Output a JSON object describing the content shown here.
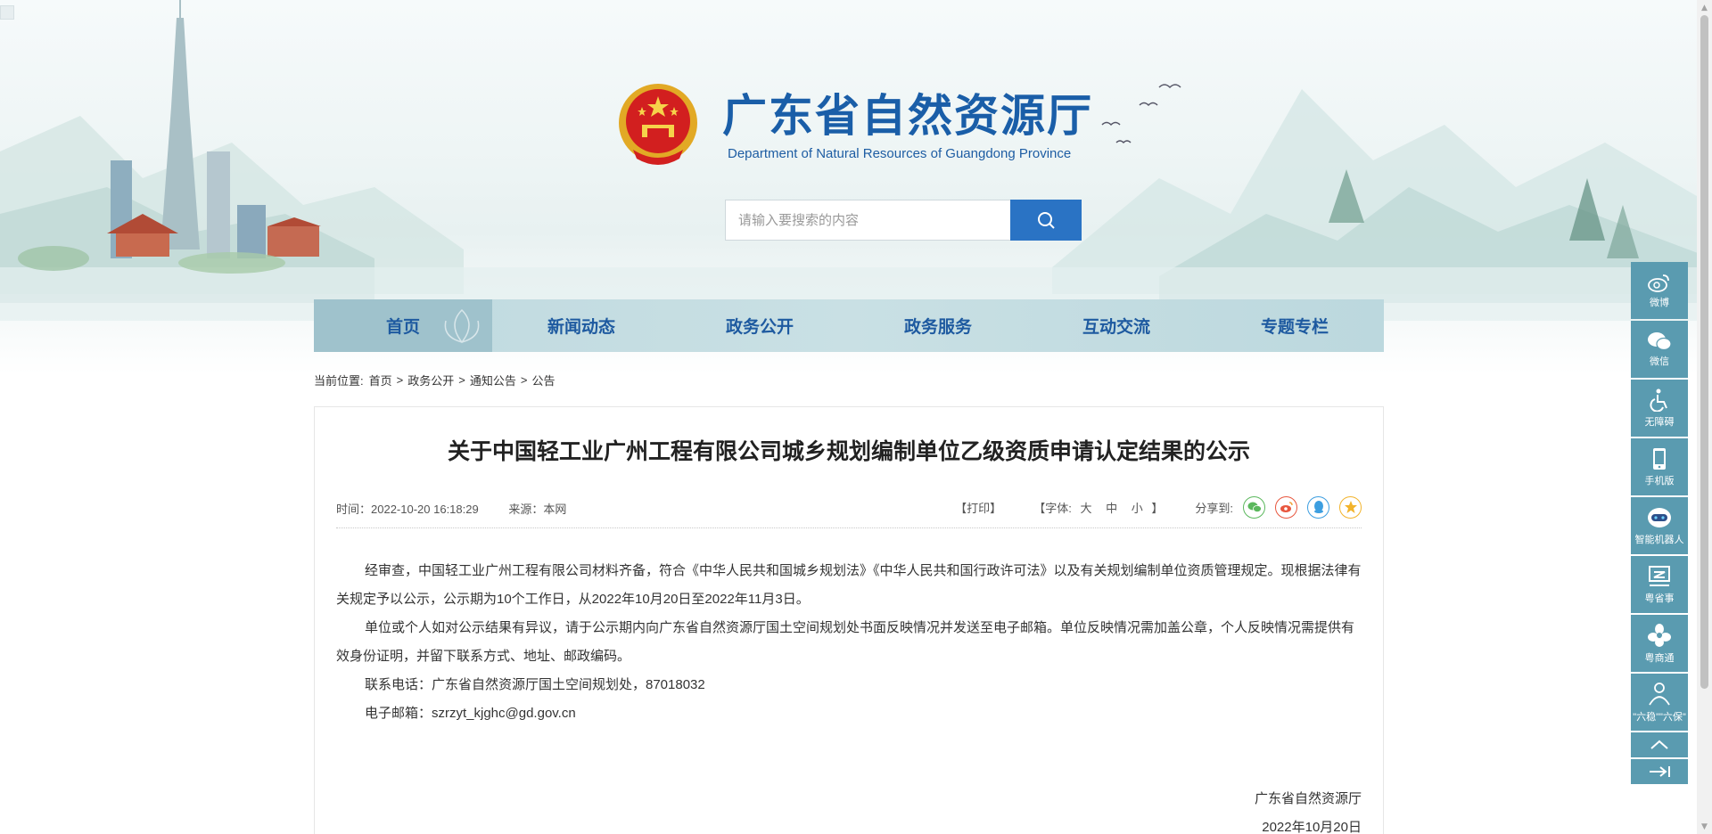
{
  "header": {
    "title": "广东省自然资源厅",
    "subtitle": "Department of Natural Resources of Guangdong Province"
  },
  "search": {
    "placeholder": "请输入要搜索的内容"
  },
  "nav": {
    "items": [
      {
        "label": "首页",
        "active": true
      },
      {
        "label": "新闻动态"
      },
      {
        "label": "政务公开"
      },
      {
        "label": "政务服务"
      },
      {
        "label": "互动交流"
      },
      {
        "label": "专题专栏"
      }
    ]
  },
  "breadcrumb": {
    "prefix": "当前位置:",
    "items": [
      "首页",
      "政务公开",
      "通知公告",
      "公告"
    ],
    "separator": ">"
  },
  "article": {
    "title": "关于中国轻工业广州工程有限公司城乡规划编制单位乙级资质申请认定结果的公示",
    "time": "时间：2022-10-20 16:18:29",
    "source": "来源：本网",
    "print": "【打印】",
    "font_size_label": "【字体:",
    "font_large": "大",
    "font_medium": "中",
    "font_small": "小",
    "font_close": "】",
    "share_label": "分享到:",
    "paragraphs": [
      "经审查，中国轻工业广州工程有限公司材料齐备，符合《中华人民共和国城乡规划法》《中华人民共和国行政许可法》以及有关规划编制单位资质管理规定。现根据法律有关规定予以公示，公示期为10个工作日，从2022年10月20日至2022年11月3日。",
      "单位或个人如对公示结果有异议，请于公示期内向广东省自然资源厅国土空间规划处书面反映情况并发送至电子邮箱。单位反映情况需加盖公章，个人反映情况需提供有效身份证明，并留下联系方式、地址、邮政编码。",
      "联系电话：广东省自然资源厅国土空间规划处，87018032",
      "电子邮箱：szrzyt_kjghc@gd.gov.cn"
    ],
    "signoff_org": "广东省自然资源厅",
    "signoff_date": "2022年10月20日"
  },
  "sidebar": {
    "items": [
      {
        "label": "微博",
        "icon": "weibo-icon"
      },
      {
        "label": "微信",
        "icon": "wechat-icon"
      },
      {
        "label": "无障碍",
        "icon": "accessibility-icon"
      },
      {
        "label": "手机版",
        "icon": "mobile-icon"
      },
      {
        "label": "智能机器人",
        "icon": "robot-icon"
      },
      {
        "label": "粤省事",
        "icon": "yueshengshi-icon"
      },
      {
        "label": "粤商通",
        "icon": "yueshangtong-icon"
      },
      {
        "label": "\"六稳\"\"六保\"",
        "icon": "liuwen-icon"
      }
    ]
  },
  "colors": {
    "brand_blue": "#1a5ea8",
    "search_button": "#2a73c4",
    "nav_bg": "#c9e0e4",
    "nav_active": "#9fc2cc",
    "sidebar_bg": "#5a9bb0",
    "share_wechat": "#5bb85d",
    "share_weibo": "#e8563e",
    "share_qq": "#3c9ee0",
    "share_favorite": "#f2b32b"
  }
}
